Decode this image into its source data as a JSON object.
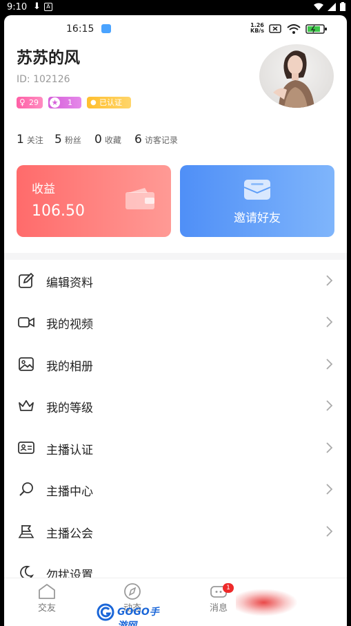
{
  "system_bar": {
    "time": "9:10"
  },
  "status_bar": {
    "time": "16:15",
    "speed_top": "1.26",
    "speed_bottom": "KB/s"
  },
  "profile": {
    "name": "苏苏的风",
    "id_text": "ID: 102126",
    "badges": {
      "gender_age": "29",
      "level": "1",
      "verified": "已认证"
    }
  },
  "stats": [
    {
      "number": "1",
      "label": "关注"
    },
    {
      "number": "5",
      "label": "粉丝"
    },
    {
      "number": "0",
      "label": "收藏"
    },
    {
      "number": "6",
      "label": "访客记录"
    }
  ],
  "cards": {
    "earnings": {
      "label": "收益",
      "value": "106.50"
    },
    "invite": {
      "label": "邀请好友"
    }
  },
  "menu": [
    {
      "label": "编辑资料",
      "icon": "edit-icon"
    },
    {
      "label": "我的视频",
      "icon": "video-icon"
    },
    {
      "label": "我的相册",
      "icon": "album-icon"
    },
    {
      "label": "我的等级",
      "icon": "crown-icon"
    },
    {
      "label": "主播认证",
      "icon": "id-card-icon"
    },
    {
      "label": "主播中心",
      "icon": "search-icon"
    },
    {
      "label": "主播公会",
      "icon": "flag-icon"
    },
    {
      "label": "勿扰设置",
      "icon": "moon-icon"
    }
  ],
  "tabs": [
    {
      "label": "交友",
      "icon": "home-icon"
    },
    {
      "label": "动态",
      "icon": "compass-icon"
    },
    {
      "label": "消息",
      "icon": "message-icon",
      "badge": "1"
    }
  ],
  "watermark": {
    "text": "GOGO手游网"
  },
  "colors": {
    "earnings_card": "#ff7a75",
    "invite_card": "#5e9ef8",
    "text_primary": "#222222",
    "badge_red": "#ee2a2a"
  }
}
